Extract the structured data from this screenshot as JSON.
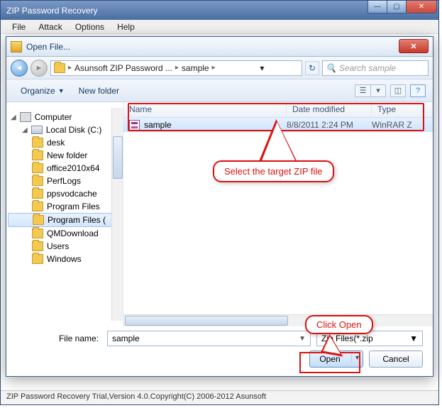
{
  "main_window": {
    "title": "ZIP Password Recovery",
    "menu": {
      "file": "File",
      "attack": "Attack",
      "options": "Options",
      "help": "Help"
    },
    "statusbar": "ZIP Password Recovery Trial,Version 4.0.Copyright(C) 2006-2012 Asunsoft"
  },
  "dialog": {
    "title": "Open File...",
    "breadcrumb": {
      "segments": [
        "Asunsoft ZIP Password ...",
        "sample"
      ]
    },
    "search_placeholder": "Search sample",
    "toolbar": {
      "organize": "Organize",
      "new_folder": "New folder"
    },
    "tree": {
      "root": "Computer",
      "drive": "Local Disk (C:)",
      "folders": [
        "desk",
        "New folder",
        "office2010x64",
        "PerfLogs",
        "ppsvodcache",
        "Program Files",
        "Program Files (",
        "QMDownload",
        "Users",
        "Windows"
      ],
      "selected_index": 6
    },
    "list": {
      "columns": {
        "name": "Name",
        "date": "Date modified",
        "type": "Type"
      },
      "rows": [
        {
          "name": "sample",
          "date": "8/8/2011 2:24 PM",
          "type": "WinRAR Z"
        }
      ],
      "selected_index": 0
    },
    "footer": {
      "filename_label": "File name:",
      "filename_value": "sample",
      "filter": "Zip Files(*.zip",
      "open": "Open",
      "cancel": "Cancel"
    }
  },
  "annotations": {
    "select_file": "Select the target ZIP file",
    "click_open": "Click Open"
  }
}
